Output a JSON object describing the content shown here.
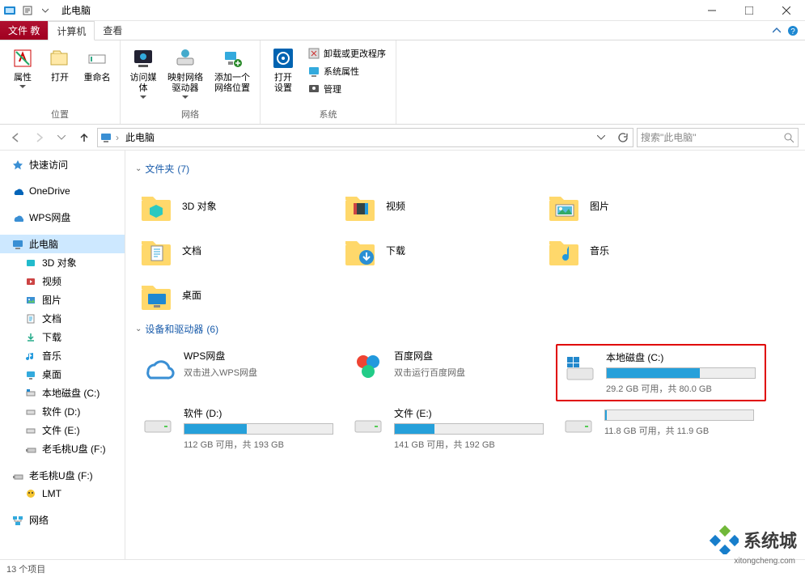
{
  "title": "此电脑",
  "tabs": {
    "file": "文件 教",
    "computer": "计算机",
    "view": "查看"
  },
  "ribbon": {
    "location": {
      "label": "位置",
      "properties": "属性",
      "open": "打开",
      "rename": "重命名"
    },
    "network": {
      "label": "网络",
      "access_media": "访问媒体",
      "map_drive": "映射网络\n驱动器",
      "add_location": "添加一个\n网络位置"
    },
    "system": {
      "label": "系统",
      "open_settings": "打开\n设置",
      "uninstall": "卸载或更改程序",
      "sys_props": "系统属性",
      "manage": "管理"
    }
  },
  "nav": {
    "breadcrumb": "此电脑",
    "refresh_tip": "刷新",
    "search_placeholder": "搜索\"此电脑\""
  },
  "sidebar": {
    "quick": "快速访问",
    "onedrive": "OneDrive",
    "wps": "WPS网盘",
    "thispc": "此电脑",
    "pc_children": [
      "3D 对象",
      "视频",
      "图片",
      "文档",
      "下载",
      "音乐",
      "桌面",
      "本地磁盘 (C:)",
      "软件 (D:)",
      "文件 (E:)",
      "老毛桃U盘 (F:)"
    ],
    "usb": "老毛桃U盘 (F:)",
    "lmt": "LMT",
    "network": "网络"
  },
  "folders_section": {
    "title": "文件夹",
    "count": "(7)"
  },
  "folders": [
    {
      "name": "3D 对象"
    },
    {
      "name": "视频"
    },
    {
      "name": "图片"
    },
    {
      "name": "文档"
    },
    {
      "name": "下载"
    },
    {
      "name": "音乐"
    },
    {
      "name": "桌面"
    }
  ],
  "drives_section": {
    "title": "设备和驱动器",
    "count": "(6)"
  },
  "drives": [
    {
      "name": "WPS网盘",
      "sub": "双击进入WPS网盘",
      "type": "cloud"
    },
    {
      "name": "百度网盘",
      "sub": "双击运行百度网盘",
      "type": "baidu"
    },
    {
      "name": "本地磁盘 (C:)",
      "sub": "29.2 GB 可用，共 80.0 GB",
      "type": "os",
      "used_pct": 63,
      "highlight": true
    },
    {
      "name": "软件 (D:)",
      "sub": "112 GB 可用，共 193 GB",
      "type": "hdd",
      "used_pct": 42
    },
    {
      "name": "文件 (E:)",
      "sub": "141 GB 可用，共 192 GB",
      "type": "hdd",
      "used_pct": 27
    },
    {
      "name": "",
      "sub": "11.8 GB 可用，共 11.9 GB",
      "type": "hdd",
      "used_pct": 1
    }
  ],
  "status": "13 个项目",
  "watermark": {
    "text": "系统城",
    "url": "xitongcheng.com"
  }
}
